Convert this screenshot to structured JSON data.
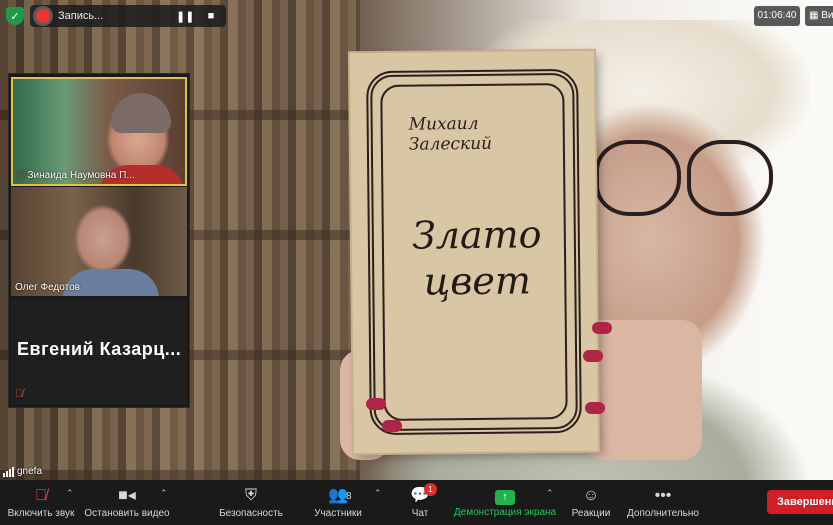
{
  "top_bar": {
    "recording_label": "Запись...",
    "pause_icon": "pause-icon",
    "stop_icon": "stop-icon",
    "time": "01:06:40",
    "view_label": "Ви"
  },
  "book": {
    "author": "Михаил Залеский",
    "title_line1": "Злато",
    "title_line2": "цвет"
  },
  "participants": [
    {
      "name": "Зинаида Наумовна П...",
      "muted": true
    },
    {
      "name": "Олег Федотов",
      "muted": false
    },
    {
      "name": "Евгений  Казарц...",
      "muted": true
    }
  ],
  "self_label": "gnefa",
  "toolbar": {
    "items": [
      {
        "label": "Включить звук",
        "icon": "mic-muted-icon"
      },
      {
        "label": "Остановить видео",
        "icon": "video-camera-icon"
      },
      {
        "label": "Безопасность",
        "icon": "shield-icon"
      },
      {
        "label": "Участники",
        "icon": "participants-icon",
        "count": "8"
      },
      {
        "label": "Чат",
        "icon": "chat-icon",
        "badge": "1"
      },
      {
        "label": "Демонстрация экрана",
        "icon": "share-screen-icon"
      },
      {
        "label": "Реакции",
        "icon": "reactions-icon"
      },
      {
        "label": "Дополнительно",
        "icon": "more-icon"
      }
    ],
    "end_label": "Завершение"
  },
  "colors": {
    "toolbar_bg": "#1a1a1a",
    "share_green": "#22c55e",
    "end_red": "#d11f25",
    "badge_red": "#e02e2e",
    "active_speaker": "#e1c24a"
  }
}
